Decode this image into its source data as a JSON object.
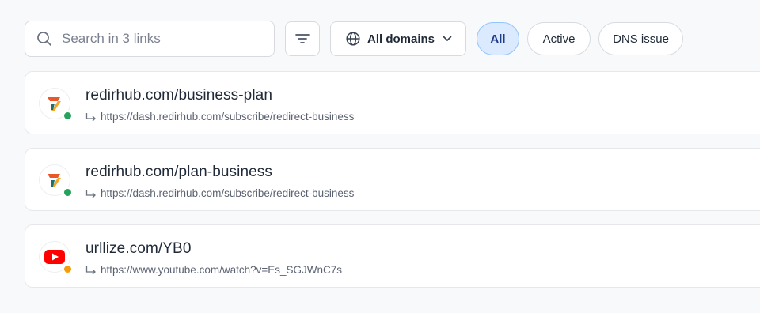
{
  "search": {
    "placeholder": "Search in 3 links",
    "value": ""
  },
  "toolbar": {
    "filter_icon": "filter-lines-icon",
    "domain_filter": {
      "label": "All domains",
      "icon": "globe-icon"
    },
    "status_tabs": [
      {
        "label": "All",
        "selected": true
      },
      {
        "label": "Active",
        "selected": false
      },
      {
        "label": "DNS issue",
        "selected": false
      }
    ]
  },
  "links": [
    {
      "short_url": "redirhub.com/business-plan",
      "destination": "https://dash.redirhub.com/subscribe/redirect-business",
      "favicon": "redirhub-logo",
      "status_color": "#22a45d"
    },
    {
      "short_url": "redirhub.com/plan-business",
      "destination": "https://dash.redirhub.com/subscribe/redirect-business",
      "favicon": "redirhub-logo",
      "status_color": "#22a45d"
    },
    {
      "short_url": "urllize.com/YB0",
      "destination": "https://www.youtube.com/watch?v=Es_SGJWnC7s",
      "favicon": "youtube-logo",
      "status_color": "#f59e0b"
    }
  ],
  "colors": {
    "accent": "#dbeafe",
    "active_dot": "#22a45d",
    "warning_dot": "#f59e0b"
  }
}
